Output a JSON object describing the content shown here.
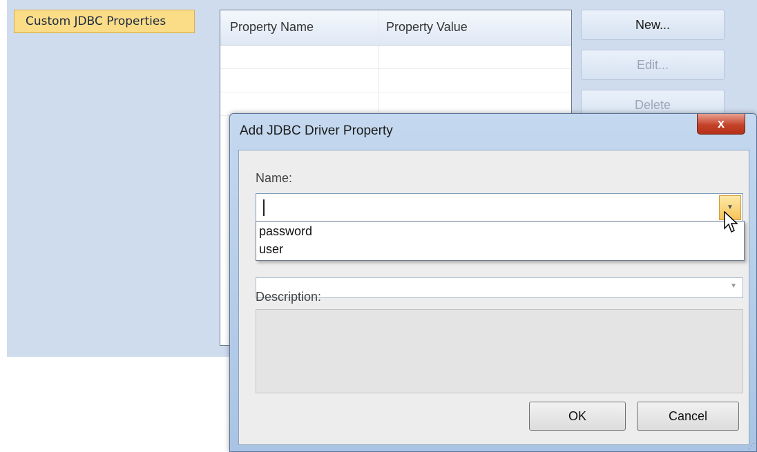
{
  "category": {
    "label": "Custom JDBC Properties"
  },
  "table": {
    "columns": [
      "Property Name",
      "Property Value"
    ],
    "rows": []
  },
  "side_buttons": {
    "new": "New...",
    "edit": "Edit...",
    "delete": "Delete"
  },
  "dialog": {
    "title": "Add JDBC Driver Property",
    "close_glyph": "x",
    "name_label": "Name:",
    "name_value": "",
    "name_options": [
      "password",
      "user"
    ],
    "value_value": "",
    "description_label": "Description:",
    "description_value": "",
    "ok_label": "OK",
    "cancel_label": "Cancel"
  },
  "colors": {
    "panel_bg": "#cfdcee",
    "selected_category": "#fbdc87",
    "close_button": "#c5432b"
  }
}
